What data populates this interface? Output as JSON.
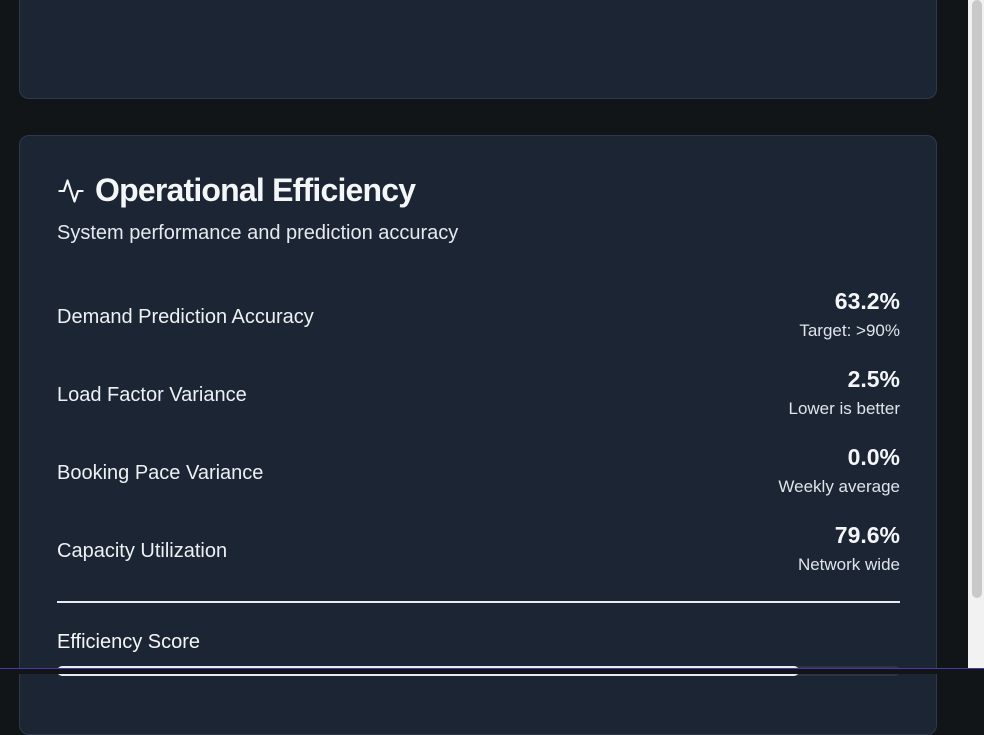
{
  "card": {
    "title": "Operational Efficiency",
    "subtitle": "System performance and prediction accuracy",
    "icon": "activity-icon"
  },
  "metrics": [
    {
      "label": "Demand Prediction Accuracy",
      "value": "63.2%",
      "note": "Target: >90%"
    },
    {
      "label": "Load Factor Variance",
      "value": "2.5%",
      "note": "Lower is better"
    },
    {
      "label": "Booking Pace Variance",
      "value": "0.0%",
      "note": "Weekly average"
    },
    {
      "label": "Capacity Utilization",
      "value": "79.6%",
      "note": "Network wide"
    }
  ],
  "efficiency": {
    "label": "Efficiency Score",
    "progress_percent": 88
  }
}
